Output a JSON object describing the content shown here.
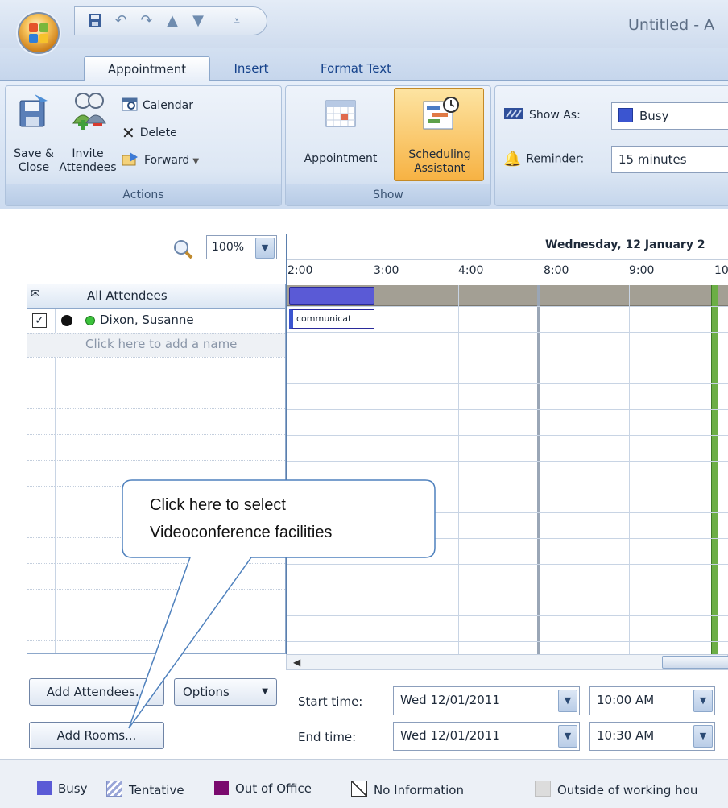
{
  "window": {
    "title": "Untitled - A"
  },
  "tabs": [
    {
      "label": "Appointment",
      "active": true
    },
    {
      "label": "Insert",
      "active": false
    },
    {
      "label": "Format Text",
      "active": false
    }
  ],
  "ribbon": {
    "actions": {
      "save_close": [
        "Save &",
        "Close"
      ],
      "invite": [
        "Invite",
        "Attendees"
      ],
      "calendar": "Calendar",
      "delete": "Delete",
      "forward": "Forward",
      "group_label": "Actions"
    },
    "show": {
      "appointment": "Appointment",
      "scheduling": [
        "Scheduling",
        "Assistant"
      ],
      "group_label": "Show"
    },
    "options": {
      "show_as_label": "Show As:",
      "show_as_value": "Busy",
      "reminder_label": "Reminder:",
      "reminder_value": "15 minutes"
    }
  },
  "zoom": {
    "value": "100%"
  },
  "attendees": {
    "header": "All Attendees",
    "rows": [
      {
        "name": "Dixon, Susanne"
      }
    ],
    "add_placeholder": "Click here to add a name"
  },
  "schedule": {
    "date_header": "Wednesday, 12 January 2",
    "times": [
      "2:00",
      "3:00",
      "4:00",
      "8:00",
      "9:00",
      "10"
    ],
    "block_label": "communicat"
  },
  "buttons": {
    "add_attendees": "Add Attendees...",
    "options": "Options",
    "add_rooms": "Add Rooms..."
  },
  "times": {
    "start_label": "Start time:",
    "start_date": "Wed 12/01/2011",
    "start_time": "10:00 AM",
    "end_label": "End time:",
    "end_date": "Wed 12/01/2011",
    "end_time": "10:30 AM"
  },
  "legend": [
    {
      "label": "Busy",
      "color": "#5a5ad6"
    },
    {
      "label": "Tentative",
      "color": "#9aa6d8"
    },
    {
      "label": "Out of Office",
      "color": "#7a0a6e"
    },
    {
      "label": "No Information",
      "color": "#ffffff"
    },
    {
      "label": "Outside of working hou",
      "color": "#dcdcdc"
    }
  ],
  "callout": {
    "lines": [
      "Click here to select",
      "Videoconference facilities"
    ]
  },
  "colors": {
    "accent": "#15428b",
    "selected": "#f7b243",
    "busy": "#5a5ad6"
  }
}
